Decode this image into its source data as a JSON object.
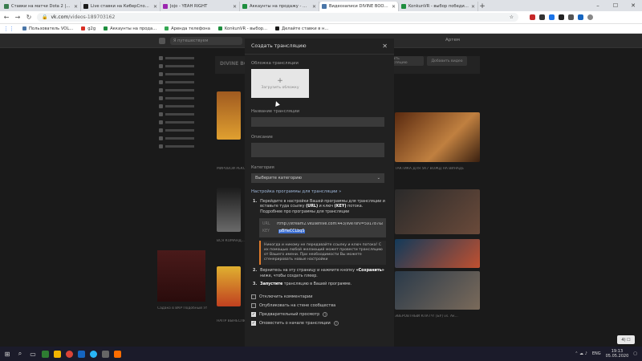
{
  "browser": {
    "tabs": [
      {
        "label": "Ставки на матчи Dota 2 | Ставк",
        "color": "#3b7d4f",
        "active": false
      },
      {
        "label": "Live ставки на КиберСпорт - ццз",
        "color": "#1a1a1a",
        "active": false
      },
      {
        "label": "Jojo - YEAH RIGHT",
        "color": "#9c27b0",
        "active": false
      },
      {
        "label": "Аккаунты на продажу - Google",
        "color": "#1e8e3e",
        "active": false
      },
      {
        "label": "Видеозаписи DIVINE BOOST - То",
        "color": "#4a76a8",
        "active": true
      },
      {
        "label": "KonkunVR - выбор победителя",
        "color": "#1e8e3e",
        "active": false
      }
    ],
    "url_host": "vk.com",
    "url_path": "/videos-189703162",
    "bookmarks": [
      {
        "label": "Пользователь VOL...",
        "color": "#4a76a8"
      },
      {
        "label": "g2g",
        "color": "#d93025"
      },
      {
        "label": "Аккаунты на прода...",
        "color": "#1e8e3e"
      },
      {
        "label": "Аренда телефона",
        "color": "#34a853"
      },
      {
        "label": "KonkunVR - выбор...",
        "color": "#1e8e3e"
      },
      {
        "label": "Делайте ставки в н...",
        "color": "#1a1a1a"
      }
    ]
  },
  "vk": {
    "search_placeholder": "Я путешествуем",
    "user": "Артем",
    "channel_name": "DIVINE BOOST",
    "top_buttons": [
      "Создать трансляцию",
      "Добавить видео"
    ],
    "captions": [
      "МИРОВОЙ РЕКОРД",
      "ВСЯ КОМАНД...",
      "ТАКТИКА ДЛЯ 5К7 ВОЖД НА ВИНАДЕ",
      "Садако в ВКР Подобный эту игру",
      "НАПР ВЫНЕСЛИ",
      "ЭВЕРОВТНЫЙ КЛАТЧ! [БУ] vs. Ак..."
    ]
  },
  "modal": {
    "title": "Создать трансляцию",
    "cover_label": "Обложка трансляции",
    "cover_button": "Загрузить обложку",
    "name_label": "Название трансляции",
    "desc_label": "Описание",
    "category_label": "Категория",
    "category_value": "Выберите категорию",
    "settings_link": "Настройка программы для трансляции »",
    "step1_pre": "Перейдите в настройки Вашей программы для трансляции и вставьте туда ссылку ",
    "step1_url": "(URL)",
    "step1_mid": " и ключ ",
    "step1_key": "(KEY)",
    "step1_post": " потока.",
    "step1_more": "Подробнее про программы для трансляции",
    "url_label": "URL",
    "url_value": "rtmp://stream2.vkuserlive.com:443/live?srv=591787&s=aWQ9",
    "key_label": "KEY",
    "key_value": "pBHeCCLbqS",
    "warning": "Никогда и никому не передавайте ссылку и ключ потока! С их помощью любой желающий может провести трансляцию от Вашего имени. При необходимости Вы можете сгенерировать новые настройки",
    "step2_pre": "Вернитесь на эту страницу и нажмите кнопку ",
    "step2_btn": "«Сохранить»",
    "step2_post": " ниже, чтобы создать плеер.",
    "step3_pre": "Запустите",
    "step3_post": " трансляцию в Вашей программе.",
    "checkboxes": [
      {
        "label": "Отключить комментарии",
        "checked": false,
        "help": false
      },
      {
        "label": "Опубликовать на стене сообщества",
        "checked": false,
        "help": false
      },
      {
        "label": "Предварительный просмотр",
        "checked": true,
        "help": true
      },
      {
        "label": "Оповестить о начале трансляции",
        "checked": true,
        "help": true
      }
    ]
  },
  "taskbar": {
    "lang": "ENG",
    "time": "19:13",
    "date": "05.05.2020",
    "volume_badge": "4) ☐"
  }
}
